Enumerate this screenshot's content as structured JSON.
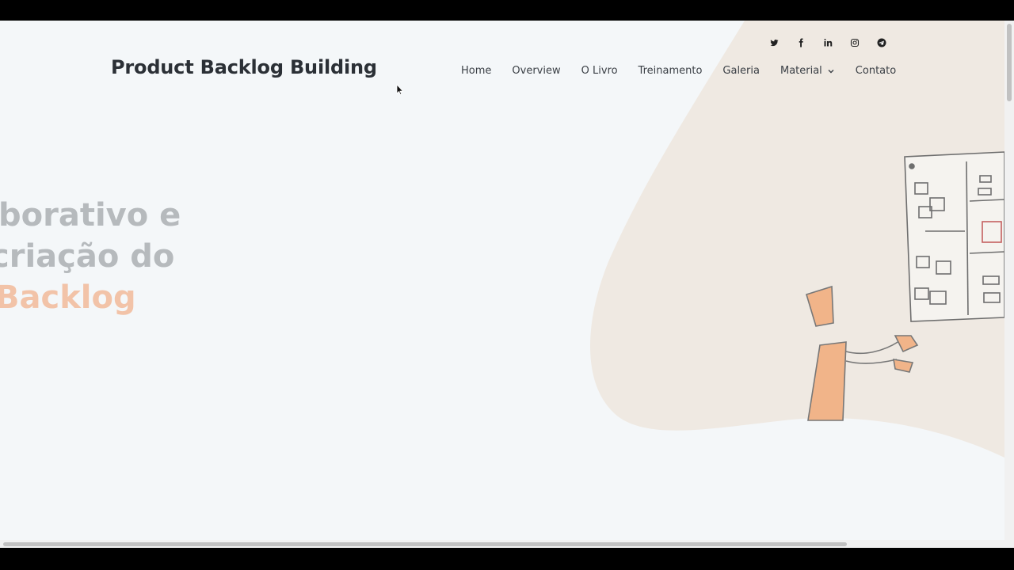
{
  "site": {
    "title": "Product Backlog Building"
  },
  "nav": {
    "items": [
      {
        "label": "Home"
      },
      {
        "label": "Overview"
      },
      {
        "label": "O Livro"
      },
      {
        "label": "Treinamento"
      },
      {
        "label": "Galeria"
      },
      {
        "label": "Material"
      },
      {
        "label": "Contato"
      }
    ]
  },
  "social": {
    "icons": [
      "twitter-icon",
      "facebook-icon",
      "linkedin-icon",
      "instagram-icon",
      "telegram-icon"
    ]
  },
  "hero": {
    "line1": "borativo e",
    "line2": "criação do",
    "line3": "Backlog"
  },
  "colors": {
    "accent": "#f2c3a8",
    "blob": "#efe9e2",
    "text": "#2b3036"
  }
}
